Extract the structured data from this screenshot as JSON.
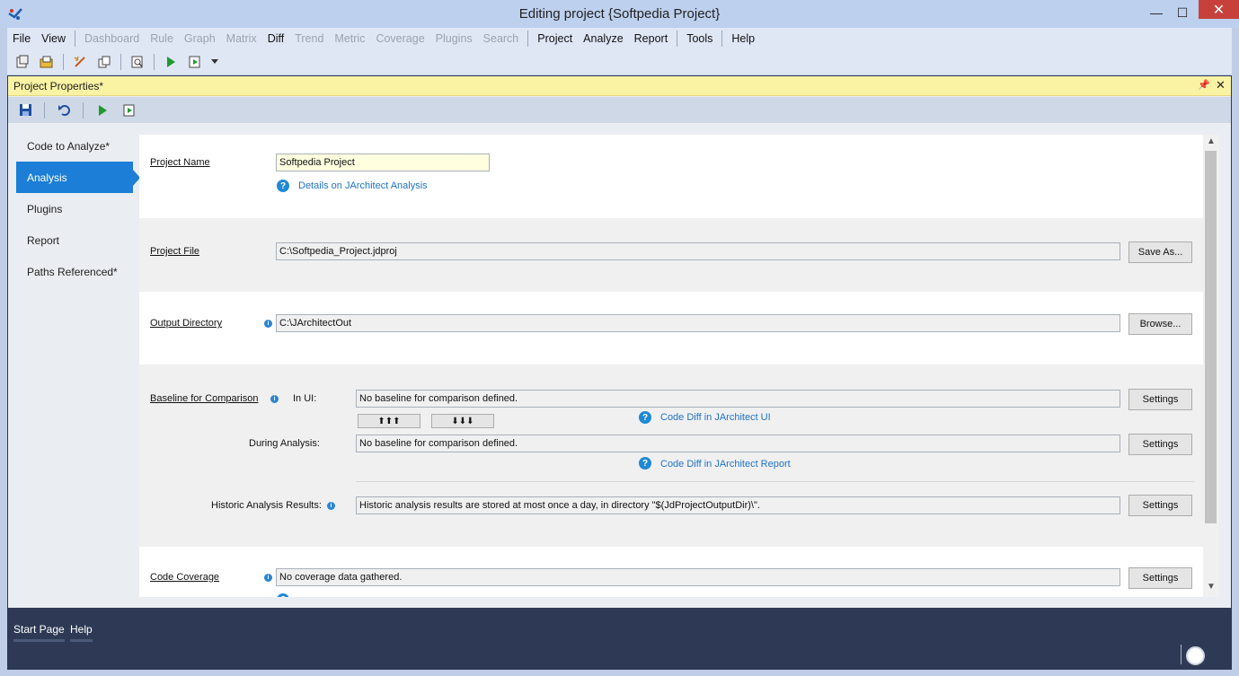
{
  "window": {
    "title": "Editing project {Softpedia Project}"
  },
  "menu": {
    "items": [
      {
        "label": "File",
        "enabled": true
      },
      {
        "label": "View",
        "enabled": true
      },
      {
        "label": "Dashboard",
        "enabled": false
      },
      {
        "label": "Rule",
        "enabled": false
      },
      {
        "label": "Graph",
        "enabled": false
      },
      {
        "label": "Matrix",
        "enabled": false
      },
      {
        "label": "Diff",
        "enabled": true
      },
      {
        "label": "Trend",
        "enabled": false
      },
      {
        "label": "Metric",
        "enabled": false
      },
      {
        "label": "Coverage",
        "enabled": false
      },
      {
        "label": "Plugins",
        "enabled": false
      },
      {
        "label": "Search",
        "enabled": false
      },
      {
        "label": "Project",
        "enabled": true
      },
      {
        "label": "Analyze",
        "enabled": true
      },
      {
        "label": "Report",
        "enabled": true
      },
      {
        "label": "Tools",
        "enabled": true
      },
      {
        "label": "Help",
        "enabled": true
      }
    ]
  },
  "panel": {
    "title": "Project Properties*"
  },
  "nav": {
    "items": [
      {
        "label": "Code to Analyze*",
        "active": false
      },
      {
        "label": "Analysis",
        "active": true
      },
      {
        "label": "Plugins",
        "active": false
      },
      {
        "label": "Report",
        "active": false
      },
      {
        "label": "Paths Referenced*",
        "active": false
      }
    ]
  },
  "project_name": {
    "label": "Project Name",
    "value": "Softpedia Project",
    "link": "Details on JArchitect Analysis"
  },
  "project_file": {
    "label": "Project File",
    "value": "C:\\Softpedia_Project.jdproj",
    "button": "Save As..."
  },
  "output_dir": {
    "label": "Output Directory",
    "value": "C:\\JArchitectOut",
    "button": "Browse..."
  },
  "baseline": {
    "label": "Baseline for Comparison",
    "in_ui_label": "In UI:",
    "in_ui_value": "No baseline for comparison defined.",
    "up_arrows": "⬆⬆⬆",
    "down_arrows": "⬇⬇⬇",
    "link_ui": "Code Diff in JArchitect UI",
    "during_label": "During Analysis:",
    "during_value": "No baseline for comparison defined.",
    "link_report": "Code Diff in JArchitect Report",
    "historic_label": "Historic Analysis Results:",
    "historic_value": "Historic analysis results are stored at most once a day, in directory \"$(JdProjectOutputDir)\\\".",
    "settings": "Settings"
  },
  "coverage": {
    "label": "Code Coverage",
    "value": "No coverage data gathered.",
    "button": "Settings"
  },
  "bottom_tabs": [
    "Start Page",
    "Help"
  ],
  "colors": {
    "accent": "#1c7ed6",
    "panel_header": "#fbf3a4",
    "link": "#1e73c8",
    "bottom_bar": "#2e3a55"
  }
}
